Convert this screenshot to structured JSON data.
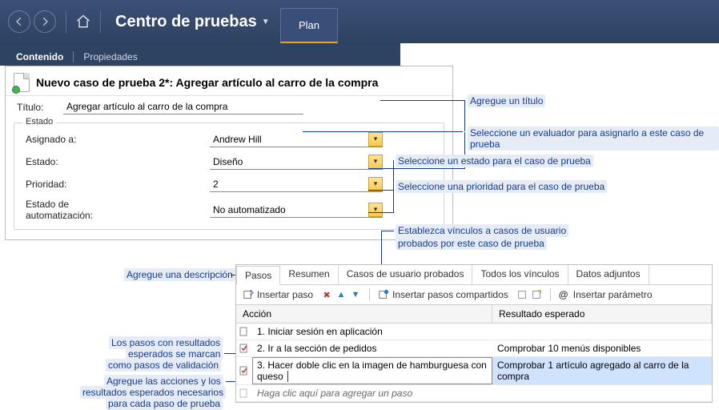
{
  "header": {
    "app_title": "Centro de pruebas",
    "tab_label": "Plan"
  },
  "subheader": {
    "tab_content": "Contenido",
    "tab_properties": "Propiedades"
  },
  "panel": {
    "title": "Nuevo caso de prueba 2*: Agregar artículo al carro de la compra",
    "title_label": "Título:",
    "title_value": "Agregar artículo al carro de la compra",
    "fieldset_label": "Estado",
    "assigned_label": "Asignado a:",
    "assigned_value": "Andrew Hill",
    "state_label": "Estado:",
    "state_value": "Diseño",
    "priority_label": "Prioridad:",
    "priority_value": "2",
    "automation_label": "Estado de automatización:",
    "automation_value": "No automatizado"
  },
  "callouts": {
    "c1": "Agregue un título",
    "c2": "Seleccione un evaluador para asignarlo a este caso de prueba",
    "c3": "Seleccione un estado para el caso de prueba",
    "c4": "Seleccione una prioridad para el caso de prueba",
    "c5a": "Establezca vínculos a casos de usuario",
    "c5b": "probados por este caso de prueba",
    "left1": "Agregue una descripción",
    "left2a": "Los pasos con resultados",
    "left2b": "esperados se marcan",
    "left2c": "como pasos de validación",
    "left3a": "Agregue las acciones y los",
    "left3b": "resultados esperados necesarios",
    "left3c": "para cada paso de prueba"
  },
  "card": {
    "tabs": {
      "steps": "Pasos",
      "summary": "Resumen",
      "userstories": "Casos de usuario probados",
      "links": "Todos los vínculos",
      "attachments": "Datos adjuntos"
    },
    "toolbar": {
      "insert_step": "Insertar paso",
      "insert_shared": "Insertar pasos compartidos",
      "insert_param": "Insertar parámetro"
    },
    "columns": {
      "action": "Acción",
      "expected": "Resultado esperado"
    },
    "rows": [
      {
        "n": "1.",
        "action": "Iniciar sesión en aplicación",
        "expected": "",
        "validated": false
      },
      {
        "n": "2.",
        "action": "Ir a la sección de pedidos",
        "expected": "Comprobar 10 menús disponibles",
        "validated": true
      },
      {
        "n": "3.",
        "action": "Hacer doble clic en la imagen de hamburguesa con queso",
        "expected": "Comprobar 1 artículo agregado al carro de la compra",
        "validated": true
      }
    ],
    "placeholder": "Haga clic aquí para agregar un paso"
  }
}
